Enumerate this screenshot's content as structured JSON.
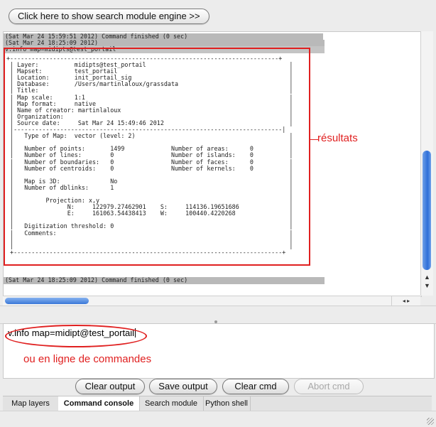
{
  "top": {
    "search_button": "Click here to show search module engine >>"
  },
  "output": {
    "status_lines": [
      "(Sat Mar 24 15:59:51 2012) Command finished (0 sec)",
      "(Sat Mar 24 18:25:09 2012)"
    ],
    "command_line": "v.info map=midipts@test_portail",
    "report_lines": [
      "+---------------------------------------------------------------------------+",
      " | Layer:          midipts@test_portail                                        |",
      " | Mapset:         test_portail                                                |",
      " | Location:       init_portail_sig                                            |",
      " | Database:       /Users/martinlaloux/grassdata                               |",
      " | Title:                                                                      |",
      " | Map scale:      1:1                                                         |",
      " | Map format:     native                                                      |",
      " | Name of creator: martinlaloux                                               |",
      " | Organization:                                                               |",
      " | Source date:     Sat Mar 24 15:49:46 2012                                   |",
      " |---------------------------------------------------------------------------|",
      " |   Type of Map:  vector (level: 2)                                           |",
      " |                                                                             |",
      " |   Number of points:       1499             Number of areas:      0          |",
      " |   Number of lines:        0                Number of islands:    0          |",
      " |   Number of boundaries:   0                Number of faces:      0          |",
      " |   Number of centroids:    0                Number of kernels:    0          |",
      " |                                                                             |",
      " |   Map is 3D:              No                                                |",
      " |   Number of dblinks:      1                                                 |",
      " |                                                                             |",
      " |         Projection: x,y                                                     |",
      " |               N:     122979.27462901    S:     114136.19651686              |",
      " |               E:     161063.54438413    W:     100440.4220268               |",
      " |                                                                             |",
      " |   Digitization threshold: 0                                                 |",
      " |   Comments:                                                                 |",
      " |                                                                             |",
      " |                                                                             |",
      " +---------------------------------------------------------------------------+"
    ],
    "finished_line": "(Sat Mar 24 18:25:09 2012) Command finished (0 sec)"
  },
  "annotations": {
    "results": "résultats",
    "command_line": "ou en ligne de commandes"
  },
  "prompt": {
    "value": "v.info map=midipt@test_portail"
  },
  "buttons": {
    "clear_output": "Clear output",
    "save_output": "Save output",
    "clear_cmd": "Clear cmd",
    "abort_cmd": "Abort cmd"
  },
  "tabs": [
    "Map layers",
    "Command console",
    "Search module",
    "Python shell"
  ],
  "scroll_arrows": {
    "up": "▲",
    "down": "▼",
    "left": "◂",
    "right": "▸"
  }
}
